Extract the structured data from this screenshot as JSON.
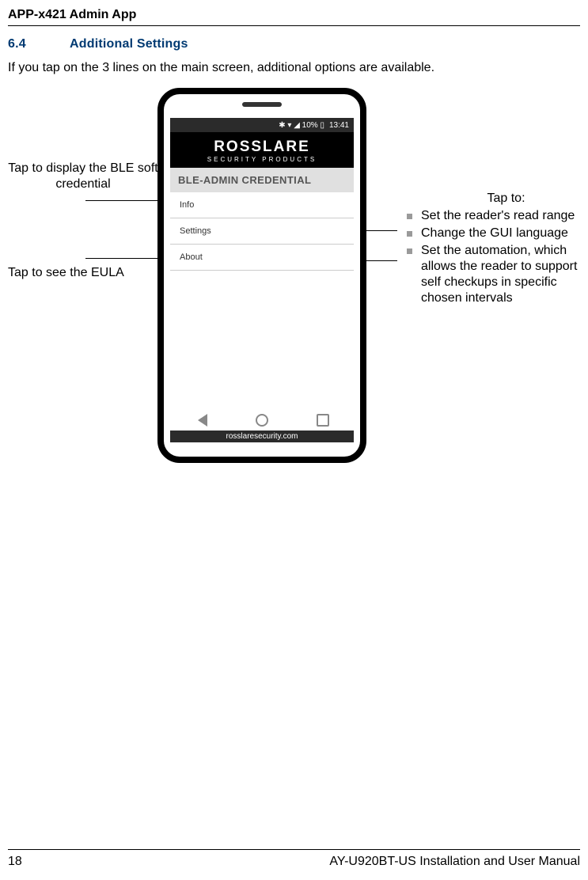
{
  "header": {
    "title": "APP-x421 Admin App"
  },
  "section": {
    "number": "6.4",
    "title": "Additional Settings"
  },
  "intro": "If you tap on the 3 lines on the main screen, additional options are available.",
  "phone": {
    "statusbar": {
      "icons": "✱  ▾ ◢  10% ▯",
      "time": "13:41"
    },
    "logo": {
      "main": "ROSSLARE",
      "sub": "SECURITY PRODUCTS"
    },
    "credential_label": "BLE-ADMIN CREDENTIAL",
    "menu": {
      "info": "Info",
      "settings": "Settings",
      "about": "About"
    },
    "footer_url": "rosslaresecurity.com"
  },
  "callouts": {
    "left1": "Tap to display the BLE soft credential",
    "left2": "Tap to see the EULA",
    "right_header": "Tap to:",
    "right_items": [
      "Set the reader's read range",
      "Change the GUI language",
      "Set the automation, which allows the reader to support self checkups in specific chosen intervals"
    ]
  },
  "footer": {
    "page": "18",
    "manual": "AY-U920BT-US Installation and User Manual"
  }
}
